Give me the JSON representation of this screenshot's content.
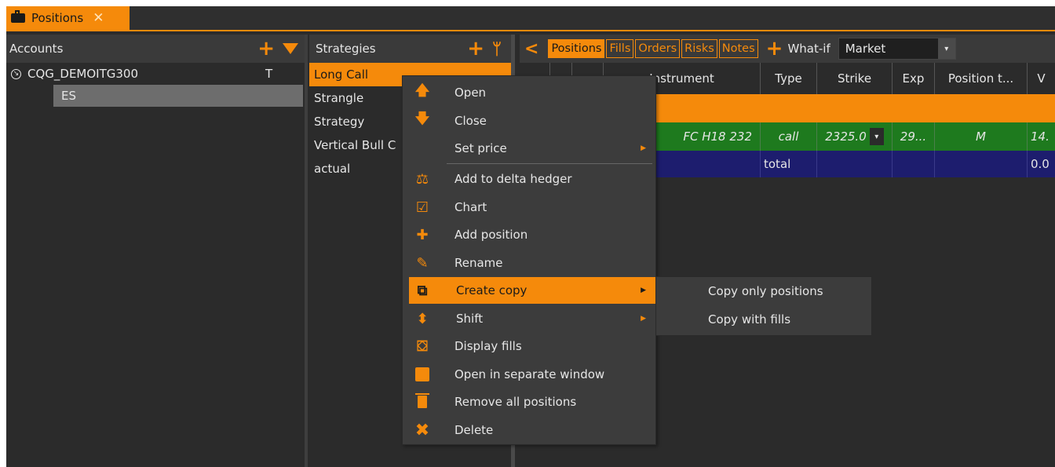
{
  "window": {
    "tab_label": "Positions",
    "tab_close": "✕"
  },
  "accounts": {
    "header": "Accounts",
    "items": [
      {
        "label": "CQG_DEMOITG300",
        "flag": "T"
      },
      {
        "label": "ES"
      }
    ]
  },
  "strategies": {
    "header": "Strategies",
    "items": [
      "Long Call",
      "Strangle",
      "Strategy",
      "Vertical Bull C",
      "actual"
    ],
    "selected": "Long Call"
  },
  "positions": {
    "tabs": [
      "Positions",
      "Fills",
      "Orders",
      "Risks",
      "Notes"
    ],
    "active_tab": "Positions",
    "whatif_label": "What-if",
    "price_mode": "Market",
    "columns": [
      "Instrument",
      "Type",
      "Strike",
      "Exp",
      "Position t...",
      "V"
    ],
    "rows": [
      {
        "instrument": "FC H18 232",
        "type": "call",
        "strike": "2325.0",
        "exp": "29...",
        "position_type": "M",
        "v": "14."
      },
      {
        "instrument": "",
        "type": "total",
        "strike": "",
        "exp": "",
        "position_type": "",
        "v": "0.0"
      }
    ]
  },
  "context_menu": {
    "items": [
      {
        "label": "Open",
        "icon": "arrow-up-icon"
      },
      {
        "label": "Close",
        "icon": "arrow-down-icon"
      },
      {
        "label": "Set price",
        "icon": "",
        "submenu": true
      },
      {
        "label": "Add to delta hedger",
        "icon": "delta-hedger-icon"
      },
      {
        "label": "Chart",
        "icon": "chart-icon"
      },
      {
        "label": "Add position",
        "icon": "plus-icon"
      },
      {
        "label": "Rename",
        "icon": "edit-icon"
      },
      {
        "label": "Create copy",
        "icon": "copy-icon",
        "submenu": true,
        "highlighted": true
      },
      {
        "label": "Shift",
        "icon": "shift-icon",
        "submenu": true
      },
      {
        "label": "Display fills",
        "icon": "fills-icon"
      },
      {
        "label": "Open in separate window",
        "icon": "external-window-icon"
      },
      {
        "label": "Remove all positions",
        "icon": "trash-icon"
      },
      {
        "label": "Delete",
        "icon": "delete-x-icon"
      }
    ],
    "create_copy_submenu": [
      "Copy only positions",
      "Copy with fills"
    ]
  },
  "colors": {
    "accent": "#f58a0b",
    "background": "#2b2b2b",
    "header": "#3a3a3a",
    "row_green": "#1e7a1e",
    "row_blue": "#1d1d6e"
  }
}
